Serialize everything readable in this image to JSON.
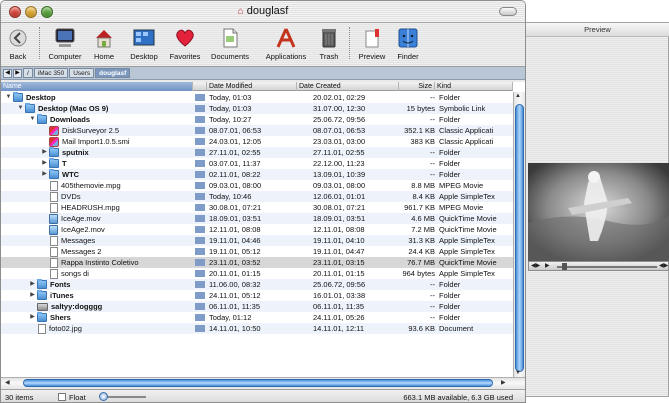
{
  "window": {
    "title": "douglasf"
  },
  "toolbar": {
    "back_label": "Back",
    "items": [
      {
        "label": "Computer",
        "icon": "computer-icon"
      },
      {
        "label": "Home",
        "icon": "home-icon"
      },
      {
        "label": "Desktop",
        "icon": "desktop-icon"
      },
      {
        "label": "Favorites",
        "icon": "favorites-heart-icon"
      },
      {
        "label": "Documents",
        "icon": "documents-icon"
      },
      {
        "label": "Applications",
        "icon": "applications-icon"
      },
      {
        "label": "Trash",
        "icon": "trash-icon"
      },
      {
        "label": "Preview",
        "icon": "preview-icon"
      },
      {
        "label": "Finder",
        "icon": "finder-icon"
      }
    ]
  },
  "pathbar": {
    "segments": [
      "/",
      "iMac 350",
      "Users",
      "douglasf"
    ]
  },
  "columns": {
    "name": "Name",
    "modified": "Date Modified",
    "created": "Date Created",
    "size": "Size",
    "kind": "Kind"
  },
  "rows": [
    {
      "name": "Desktop",
      "mod": "Today, 01:03",
      "cre": "20.02.01, 02:29",
      "size": "--",
      "kind": "Folder",
      "level": 0,
      "tri": "down",
      "icon": "folder",
      "bold": true
    },
    {
      "name": "Desktop (Mac OS 9)",
      "mod": "Today, 01:03",
      "cre": "31.07.00, 12:30",
      "size": "15 bytes",
      "kind": "Symbolic Link",
      "level": 1,
      "tri": "down",
      "icon": "folder",
      "bold": true
    },
    {
      "name": "Downloads",
      "mod": "Today, 10:27",
      "cre": "25.06.72, 09:56",
      "size": "--",
      "kind": "Folder",
      "level": 2,
      "tri": "down",
      "icon": "folder",
      "bold": true
    },
    {
      "name": "DiskSurveyor 2.5",
      "mod": "08.07.01, 06:53",
      "cre": "08.07.01, 06:53",
      "size": "352.1 KB",
      "kind": "Classic Applicati",
      "level": 3,
      "tri": "",
      "icon": "app",
      "bold": false
    },
    {
      "name": "Mail Import1.0.5.smi",
      "mod": "24.03.01, 12:05",
      "cre": "23.03.01, 03:00",
      "size": "383 KB",
      "kind": "Classic Applicati",
      "level": 3,
      "tri": "",
      "icon": "app",
      "bold": false
    },
    {
      "name": "sputnix",
      "mod": "27.11.01, 02:55",
      "cre": "27.11.01, 02:55",
      "size": "--",
      "kind": "Folder",
      "level": 3,
      "tri": "right",
      "icon": "folder",
      "bold": true
    },
    {
      "name": "T",
      "mod": "03.07.01, 11:37",
      "cre": "22.12.00, 11:23",
      "size": "--",
      "kind": "Folder",
      "level": 3,
      "tri": "right",
      "icon": "folder",
      "bold": true
    },
    {
      "name": "WTC",
      "mod": "02.11.01, 08:22",
      "cre": "13.09.01, 10:39",
      "size": "--",
      "kind": "Folder",
      "level": 3,
      "tri": "right",
      "icon": "folder",
      "bold": true
    },
    {
      "name": "405themovie.mpg",
      "mod": "09.03.01, 08:00",
      "cre": "09.03.01, 08:00",
      "size": "8.8 MB",
      "kind": "MPEG Movie",
      "level": 3,
      "tri": "",
      "icon": "doc",
      "bold": false
    },
    {
      "name": "DVDs",
      "mod": "Today, 10:46",
      "cre": "12.06.01, 01:01",
      "size": "8.4 KB",
      "kind": "Apple SimpleTex",
      "level": 3,
      "tri": "",
      "icon": "doc",
      "bold": false
    },
    {
      "name": "HEADRUSH.mpg",
      "mod": "30.08.01, 07:21",
      "cre": "30.08.01, 07:21",
      "size": "961.7 KB",
      "kind": "MPEG Movie",
      "level": 3,
      "tri": "",
      "icon": "doc",
      "bold": false
    },
    {
      "name": "IceAge.mov",
      "mod": "18.09.01, 03:51",
      "cre": "18.09.01, 03:51",
      "size": "4.6 MB",
      "kind": "QuickTime Movie",
      "level": 3,
      "tri": "",
      "icon": "mov",
      "bold": false
    },
    {
      "name": "IceAge2.mov",
      "mod": "12.11.01, 08:08",
      "cre": "12.11.01, 08:08",
      "size": "7.2 MB",
      "kind": "QuickTime Movie",
      "level": 3,
      "tri": "",
      "icon": "mov",
      "bold": false
    },
    {
      "name": "Messages",
      "mod": "19.11.01, 04:46",
      "cre": "19.11.01, 04:10",
      "size": "31.3 KB",
      "kind": "Apple SimpleTex",
      "level": 3,
      "tri": "",
      "icon": "doc",
      "bold": false
    },
    {
      "name": "Messages 2",
      "mod": "19.11.01, 05:12",
      "cre": "19.11.01, 04:47",
      "size": "24.4 KB",
      "kind": "Apple SimpleTex",
      "level": 3,
      "tri": "",
      "icon": "doc",
      "bold": false
    },
    {
      "name": "Rappa Instinto Coletivo",
      "mod": "23.11.01, 03:52",
      "cre": "23.11.01, 03:15",
      "size": "76.7 MB",
      "kind": "QuickTime Movie",
      "level": 3,
      "tri": "",
      "icon": "doc",
      "bold": false,
      "highlight": true
    },
    {
      "name": "songs di",
      "mod": "20.11.01, 01:15",
      "cre": "20.11.01, 01:15",
      "size": "964 bytes",
      "kind": "Apple SimpleTex",
      "level": 3,
      "tri": "",
      "icon": "doc",
      "bold": false
    },
    {
      "name": "Fonts",
      "mod": "11.06.00, 08:32",
      "cre": "25.06.72, 09:56",
      "size": "--",
      "kind": "Folder",
      "level": 2,
      "tri": "right",
      "icon": "folder",
      "bold": true
    },
    {
      "name": "iTunes",
      "mod": "24.11.01, 05:12",
      "cre": "16.01.01, 03:38",
      "size": "--",
      "kind": "Folder",
      "level": 2,
      "tri": "right",
      "icon": "folder",
      "bold": true
    },
    {
      "name": "saltyy:dogggg",
      "mod": "06.11.01, 11:35",
      "cre": "06.11.01, 11:35",
      "size": "--",
      "kind": "Folder",
      "level": 2,
      "tri": "",
      "icon": "drive",
      "bold": true
    },
    {
      "name": "Shers",
      "mod": "Today, 01:12",
      "cre": "24.11.01, 05:26",
      "size": "--",
      "kind": "Folder",
      "level": 2,
      "tri": "right",
      "icon": "folder",
      "bold": true
    },
    {
      "name": "foto02.jpg",
      "mod": "14.11.01, 10:50",
      "cre": "14.11.01, 12:11",
      "size": "93.6 KB",
      "kind": "Document",
      "level": 2,
      "tri": "",
      "icon": "doc",
      "bold": false
    }
  ],
  "status": {
    "items": "30 items",
    "float": "Float",
    "available": "663.1 MB available, 6.3 GB used"
  },
  "preview": {
    "title": "Preview"
  },
  "colors": {
    "selection": "#7b97bd",
    "scroll_blue": "#4a8fd8",
    "row_alt": "#eef3fb"
  }
}
